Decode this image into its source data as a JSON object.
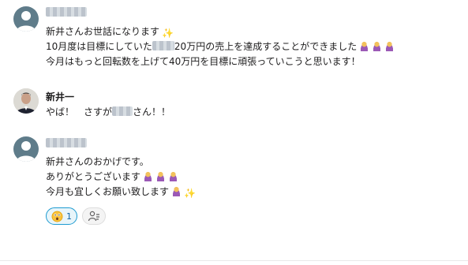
{
  "messages": [
    {
      "sender": "",
      "lines": [
        "新井さんお世話になります",
        "10月度は目標にしていた",
        "20万円の売上を達成することができました",
        "今月はもっと回転数を上げて40万円を目標に頑張っていこうと思います！"
      ]
    },
    {
      "sender": "新井一",
      "line_prefix": "やば！　さすが",
      "line_suffix": "さん！！"
    },
    {
      "sender": "",
      "lines": [
        "新井さんのおかげです。",
        "ありがとうございます",
        "今月も宜しくお願い致します"
      ],
      "reaction": {
        "icon": "surprised-face-icon",
        "count": "1"
      }
    }
  ],
  "icons": {
    "sparkle": "sparkles-icon",
    "bow": "person-bowing-icon"
  },
  "colors": {
    "reaction_border": "#1d9bd1",
    "reaction_bg": "#e8f5fa",
    "avatar_generic": "#5f7c8a"
  }
}
